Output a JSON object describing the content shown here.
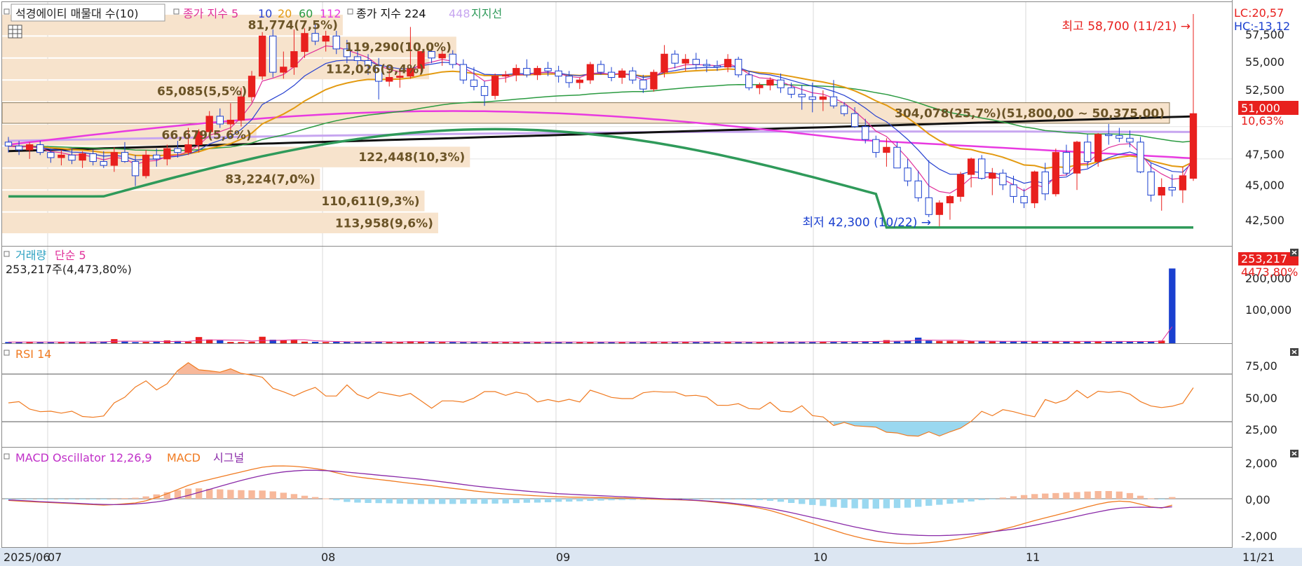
{
  "price_panel": {
    "legend": {
      "item1": "석경에이티 매물대 수(10)",
      "item2_label": "종가 지수 5",
      "ma10": "10",
      "ma20": "20",
      "ma60": "60",
      "ma112": "112",
      "item3_label": "종가 지수 224",
      "ma448": "448",
      "support": "지지선"
    },
    "lc": "LC:20,57",
    "hc": "HC:-13,12",
    "high_marker": "최고 58,700 (11/21) →",
    "low_marker": "최저 42,300 (10/22) →",
    "current_price": "51,000",
    "current_change": "10,63%",
    "y_ticks": [
      "57,500",
      "55,000",
      "52,500",
      "50,000",
      "47,500",
      "45,000",
      "42,500"
    ],
    "volume_profile": [
      {
        "label": "81,774(7,5%)"
      },
      {
        "label": "119,290(10,0%)"
      },
      {
        "label": "112,026(9,4%)"
      },
      {
        "label": "65,085(5,5%)"
      },
      {
        "label": "304,078(25,7%)(51,800,00 ~ 50,375,00)"
      },
      {
        "label": "66,679(5,6%)"
      },
      {
        "label": "122,448(10,3%)"
      },
      {
        "label": "83,224(7,0%)"
      },
      {
        "label": "110,611(9,3%)"
      },
      {
        "label": "113,958(9,6%)"
      }
    ]
  },
  "volume_panel": {
    "legend_label": "거래량",
    "legend_ma": "단순 5",
    "summary": "253,217주(4,473,80%)",
    "current_volume": "253,217",
    "current_ratio": "4473,80%",
    "y_ticks": [
      "200,000",
      "100,000"
    ]
  },
  "rsi_panel": {
    "legend": "RSI 14",
    "y_ticks": [
      "75,00",
      "50,00",
      "25,00"
    ]
  },
  "macd_panel": {
    "legend_osc": "MACD Oscillator 12,26,9",
    "legend_macd": "MACD",
    "legend_signal": "시그널",
    "y_ticks": [
      "2,000",
      "0,00",
      "-2,000"
    ]
  },
  "x_axis": {
    "labels": [
      "2025/06",
      "07",
      "08",
      "09",
      "10",
      "11"
    ],
    "last_date": "11/21"
  },
  "colors": {
    "up": "#e8201e",
    "down": "#1a3fcf",
    "ma5": "#e0309a",
    "ma10": "#2640d0",
    "ma20": "#e39a10",
    "ma60": "#2a9a40",
    "ma112": "#e83ae0",
    "ma224": "#111111",
    "ma448": "#c7a6f0",
    "support": "#2f9a5a",
    "profile": "#f7e3cc",
    "rsi": "#f07a20",
    "macd": "#f07a20",
    "signal": "#8a2aa8",
    "osc_pos": "#f7b89a",
    "osc_neg": "#9ad8f0"
  },
  "chart_data": {
    "type": "candlestick",
    "title": "석경에이티",
    "y_range": [
      41000,
      58700
    ],
    "candles": [
      [
        48800,
        49200,
        48000,
        48500
      ],
      [
        48500,
        48900,
        47800,
        48200
      ],
      [
        48200,
        48800,
        47500,
        48600
      ],
      [
        48600,
        48900,
        47800,
        48000
      ],
      [
        48000,
        48300,
        47200,
        47600
      ],
      [
        47600,
        48200,
        47000,
        47800
      ],
      [
        47800,
        48300,
        47100,
        47400
      ],
      [
        47400,
        48100,
        46800,
        47900
      ],
      [
        47900,
        48200,
        47000,
        47300
      ],
      [
        47300,
        48100,
        46800,
        47000
      ],
      [
        47000,
        48400,
        46500,
        48000
      ],
      [
        48000,
        48800,
        47200,
        47300
      ],
      [
        47300,
        47800,
        45400,
        46200
      ],
      [
        46200,
        48200,
        46000,
        47800
      ],
      [
        47800,
        48300,
        46900,
        47500
      ],
      [
        47500,
        48600,
        47000,
        48300
      ],
      [
        48300,
        48900,
        47600,
        48000
      ],
      [
        48000,
        49900,
        47800,
        48600
      ],
      [
        48600,
        49800,
        48000,
        49600
      ],
      [
        49600,
        51200,
        49100,
        50800
      ],
      [
        50800,
        51400,
        49900,
        50200
      ],
      [
        50200,
        51800,
        49400,
        50500
      ],
      [
        50500,
        53000,
        50000,
        52300
      ],
      [
        52300,
        54300,
        51900,
        53900
      ],
      [
        53900,
        57300,
        53600,
        57000
      ],
      [
        57000,
        57500,
        53800,
        54200
      ],
      [
        54200,
        55800,
        53700,
        54600
      ],
      [
        54600,
        57500,
        54000,
        55800
      ],
      [
        55800,
        57600,
        55300,
        57200
      ],
      [
        57200,
        57900,
        56300,
        56600
      ],
      [
        56600,
        57400,
        55800,
        57000
      ],
      [
        57000,
        57400,
        55600,
        56000
      ],
      [
        56000,
        56700,
        54900,
        55400
      ],
      [
        55400,
        56400,
        54600,
        55100
      ],
      [
        55100,
        55600,
        54000,
        54700
      ],
      [
        54700,
        55300,
        52100,
        53500
      ],
      [
        53500,
        54500,
        53100,
        53800
      ],
      [
        53800,
        54400,
        53000,
        53900
      ],
      [
        53900,
        57700,
        53700,
        54500
      ],
      [
        54500,
        55400,
        54100,
        55800
      ],
      [
        55800,
        56200,
        54900,
        55300
      ],
      [
        55300,
        56100,
        54700,
        55600
      ],
      [
        55600,
        55900,
        54500,
        54800
      ],
      [
        54800,
        55200,
        53300,
        53600
      ],
      [
        53600,
        54600,
        52800,
        53100
      ],
      [
        53100,
        53500,
        51600,
        52400
      ],
      [
        52400,
        54100,
        52100,
        53900
      ],
      [
        53900,
        54300,
        53400,
        54000
      ],
      [
        54000,
        54800,
        53500,
        54500
      ],
      [
        54500,
        55200,
        53800,
        54000
      ],
      [
        54000,
        54700,
        53600,
        54500
      ],
      [
        54500,
        55000,
        53900,
        54300
      ],
      [
        54300,
        54700,
        53400,
        53900
      ],
      [
        53900,
        54300,
        53000,
        53400
      ],
      [
        53400,
        53800,
        52900,
        53600
      ],
      [
        53600,
        55000,
        53300,
        54800
      ],
      [
        54800,
        55100,
        54000,
        54200
      ],
      [
        54200,
        54600,
        53500,
        53800
      ],
      [
        53800,
        54500,
        53300,
        54300
      ],
      [
        54300,
        54600,
        53300,
        53600
      ],
      [
        53600,
        54000,
        52600,
        52900
      ],
      [
        52900,
        54400,
        52700,
        54200
      ],
      [
        54200,
        56300,
        53800,
        55600
      ],
      [
        55600,
        55900,
        54500,
        54900
      ],
      [
        54900,
        55600,
        54300,
        55200
      ],
      [
        55200,
        55700,
        54400,
        54800
      ],
      [
        54800,
        55200,
        54200,
        54700
      ],
      [
        54700,
        55100,
        54300,
        54600
      ],
      [
        54600,
        55600,
        54200,
        55200
      ],
      [
        55200,
        55400,
        53800,
        54000
      ],
      [
        54000,
        54300,
        52800,
        53000
      ],
      [
        53000,
        53400,
        52500,
        53200
      ],
      [
        53200,
        53800,
        52800,
        53600
      ],
      [
        53600,
        54100,
        52600,
        53000
      ],
      [
        53000,
        53400,
        52200,
        52500
      ],
      [
        52500,
        53200,
        51300,
        52300
      ],
      [
        52300,
        53400,
        51100,
        52100
      ],
      [
        52100,
        52800,
        51200,
        52300
      ],
      [
        52300,
        53600,
        51400,
        51600
      ],
      [
        51600,
        51900,
        50800,
        51000
      ],
      [
        51000,
        51500,
        49900,
        50000
      ],
      [
        50000,
        50600,
        48700,
        49000
      ],
      [
        49000,
        49300,
        47600,
        48000
      ],
      [
        48000,
        49100,
        46900,
        48400
      ],
      [
        48400,
        48800,
        46800,
        46800
      ],
      [
        46800,
        47500,
        45400,
        45800
      ],
      [
        45800,
        46600,
        44200,
        44500
      ],
      [
        44500,
        47400,
        43000,
        43200
      ],
      [
        43200,
        44300,
        42300,
        44100
      ],
      [
        44100,
        44700,
        42800,
        44600
      ],
      [
        44600,
        46500,
        44200,
        46300
      ],
      [
        46300,
        47600,
        45300,
        47500
      ],
      [
        47500,
        47800,
        45900,
        46000
      ],
      [
        46000,
        46800,
        44700,
        46400
      ],
      [
        46400,
        46700,
        45100,
        45500
      ],
      [
        45500,
        46200,
        44100,
        44600
      ],
      [
        44600,
        45200,
        43700,
        44100
      ],
      [
        44100,
        46600,
        43700,
        46500
      ],
      [
        46500,
        47200,
        44300,
        44800
      ],
      [
        44800,
        48300,
        44600,
        48000
      ],
      [
        48000,
        48600,
        46200,
        46400
      ],
      [
        46400,
        48900,
        45100,
        48800
      ],
      [
        48800,
        49400,
        46800,
        47300
      ],
      [
        47300,
        49500,
        46900,
        49400
      ],
      [
        49400,
        50200,
        48600,
        49300
      ],
      [
        49300,
        49900,
        48800,
        49100
      ],
      [
        49100,
        49700,
        48400,
        48800
      ],
      [
        48800,
        49200,
        46400,
        46500
      ],
      [
        46500,
        47200,
        44200,
        44700
      ],
      [
        44700,
        46000,
        43500,
        45300
      ],
      [
        45300,
        46300,
        44600,
        45100
      ],
      [
        45100,
        46900,
        44100,
        46200
      ],
      [
        46000,
        58700,
        45800,
        51000
      ]
    ],
    "volume_y_range": [
      0,
      280000
    ],
    "volume": [
      4200,
      3800,
      5100,
      3900,
      3500,
      4400,
      4200,
      5000,
      4600,
      6000,
      14000,
      5500,
      4000,
      4500,
      5200,
      9500,
      7600,
      5300,
      21000,
      12500,
      9800,
      4500,
      4200,
      5200,
      22000,
      12000,
      9300,
      10500,
      5400,
      4800,
      4200,
      5000,
      5200,
      4600,
      4300,
      5500,
      4400,
      4000,
      6800,
      4900,
      4700,
      4100,
      4500,
      4300,
      5000,
      4300,
      4600,
      4300,
      4500,
      4000,
      4300,
      4100,
      4700,
      4400,
      4200,
      4000,
      4300,
      4100,
      4500,
      4200,
      4800,
      4600,
      4800,
      4500,
      4600,
      5500,
      4200,
      4100,
      4800,
      4000,
      4400,
      4600,
      4300,
      4400,
      4700,
      5100,
      5300,
      5500,
      5400,
      5000,
      5600,
      6700,
      7000,
      10500,
      6000,
      9200,
      19000,
      8800,
      7600,
      7900,
      7400,
      6900,
      6500,
      6500,
      6300,
      6600,
      6600,
      6100,
      6300,
      6000,
      6200,
      5900,
      6200,
      6400,
      6000,
      5900,
      5700,
      5800,
      6600,
      8900,
      253217
    ],
    "rsi_y_range": [
      10,
      90
    ],
    "rsi_levels": [
      70,
      30
    ],
    "rsi": [
      45.8,
      46.8,
      40.6,
      38.4,
      38.8,
      37.2,
      38.8,
      34.4,
      33.7,
      34.8,
      45.8,
      50.6,
      59.1,
      64.3,
      56.7,
      61.8,
      72.9,
      79.6,
      73.6,
      72.7,
      71.6,
      74.4,
      70.6,
      69.2,
      67.3,
      58.1,
      55.1,
      51.6,
      55.5,
      58.8,
      51.6,
      51.6,
      60.9,
      52.8,
      49.5,
      54.9,
      53.2,
      51.5,
      53.7,
      47.6,
      41.3,
      47.5,
      47.5,
      46.4,
      49.8,
      55.3,
      55.3,
      52.1,
      54.8,
      53.1,
      46.6,
      48.6,
      46.7,
      48.8,
      46.6,
      56.5,
      53.6,
      50.4,
      49.4,
      49.4,
      54.3,
      55.4,
      54.9,
      54.9,
      51.7,
      52.2,
      50.6,
      43.8,
      43.7,
      45.1,
      41.0,
      40.6,
      46.3,
      38.8,
      38.2,
      43.4,
      35.1,
      34.0,
      26.8,
      29.4,
      26.6,
      26.0,
      25.4,
      21.2,
      20.5,
      18.3,
      17.9,
      21.5,
      18.0,
      21.5,
      24.6,
      30.3,
      38.7,
      35.0,
      40.1,
      38.4,
      36.0,
      34.1,
      48.6,
      45.6,
      48.5,
      56.3,
      50.0,
      55.6,
      54.6,
      55.5,
      53.2,
      46.9,
      43.2,
      41.9,
      43.0,
      45.5,
      58.5
    ],
    "macd_y_range": [
      -2800,
      2800
    ],
    "macd": [
      -100,
      -140,
      -170,
      -200,
      -230,
      -260,
      -290,
      -320,
      -350,
      -380,
      -350,
      -300,
      -250,
      -120,
      70,
      300,
      550,
      800,
      1000,
      1150,
      1300,
      1450,
      1600,
      1750,
      1880,
      1950,
      1960,
      1940,
      1880,
      1800,
      1700,
      1550,
      1400,
      1300,
      1220,
      1150,
      1080,
      1000,
      920,
      850,
      780,
      700,
      620,
      550,
      470,
      400,
      340,
      290,
      250,
      210,
      170,
      140,
      120,
      100,
      90,
      80,
      70,
      60,
      40,
      20,
      0,
      -20,
      -40,
      -60,
      -80,
      -110,
      -160,
      -220,
      -290,
      -360,
      -450,
      -560,
      -700,
      -880,
      -1080,
      -1280,
      -1480,
      -1680,
      -1880,
      -2080,
      -2250,
      -2400,
      -2520,
      -2600,
      -2650,
      -2680,
      -2660,
      -2620,
      -2560,
      -2480,
      -2380,
      -2260,
      -2120,
      -1980,
      -1820,
      -1660,
      -1480,
      -1300,
      -1140,
      -980,
      -820,
      -650,
      -480,
      -320,
      -200,
      -140,
      -180,
      -320,
      -480,
      -550,
      -380
    ],
    "signal": [
      -70,
      -100,
      -130,
      -170,
      -200,
      -230,
      -260,
      -290,
      -320,
      -340,
      -350,
      -340,
      -310,
      -260,
      -190,
      -90,
      40,
      200,
      380,
      560,
      740,
      920,
      1090,
      1250,
      1390,
      1510,
      1600,
      1660,
      1700,
      1700,
      1680,
      1640,
      1590,
      1530,
      1470,
      1410,
      1350,
      1290,
      1230,
      1160,
      1090,
      1010,
      930,
      850,
      770,
      700,
      630,
      570,
      510,
      450,
      400,
      350,
      300,
      270,
      240,
      210,
      180,
      150,
      120,
      90,
      60,
      30,
      0,
      -30,
      -60,
      -90,
      -130,
      -180,
      -240,
      -310,
      -390,
      -480,
      -580,
      -700,
      -830,
      -970,
      -1110,
      -1250,
      -1390,
      -1540,
      -1680,
      -1810,
      -1930,
      -2030,
      -2100,
      -2150,
      -2180,
      -2200,
      -2200,
      -2180,
      -2150,
      -2100,
      -2040,
      -1970,
      -1890,
      -1810,
      -1700,
      -1580,
      -1450,
      -1320,
      -1190,
      -1050,
      -910,
      -780,
      -660,
      -570,
      -520,
      -500,
      -510,
      -530,
      -480
    ]
  }
}
